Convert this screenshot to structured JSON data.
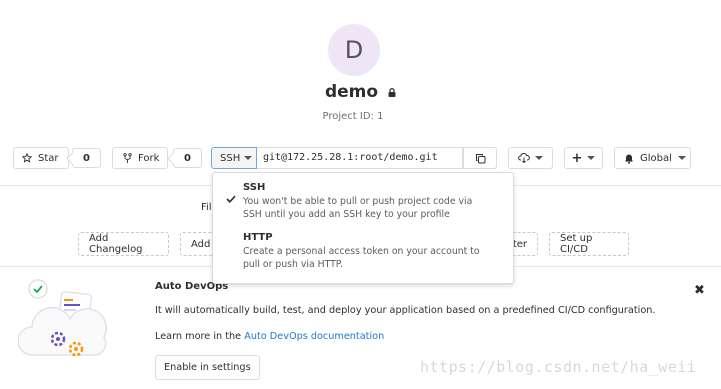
{
  "project": {
    "avatar_letter": "D",
    "name": "demo",
    "id_text": "Project ID: 1"
  },
  "actions": {
    "star_label": "Star",
    "star_count": "0",
    "fork_label": "Fork",
    "fork_count": "0",
    "protocol_label": "SSH",
    "clone_url": "git@172.25.28.1:root/demo.git",
    "notification_label": "Global"
  },
  "clone_dropdown": {
    "items": [
      {
        "title": "SSH",
        "description_line1": "You won't be able to pull or push project code via",
        "description_line2": "SSH until you add an SSH key to your profile",
        "checked": true
      },
      {
        "title": "HTTP",
        "description_line1": "Create a personal access token on your account to",
        "description_line2": "pull or push via HTTP.",
        "checked": false
      }
    ]
  },
  "quick_links": {
    "files_label": "Fil",
    "add_changelog": "Add Changelog",
    "add_partial": "Add",
    "partial_right": "ter",
    "setup_ci": "Set up CI/CD"
  },
  "auto_devops": {
    "title": "Auto DevOps",
    "description": "It will automatically build, test, and deploy your application based on a predefined CI/CD configuration.",
    "learn_prefix": "Learn more in the ",
    "learn_link": "Auto DevOps documentation",
    "enable_button": "Enable in settings",
    "close_glyph": "✖"
  },
  "watermark": "https://blog.csdn.net/ha_weii",
  "colors": {
    "avatar_bg": "#eee6f7",
    "link": "#1f78d1",
    "border": "#dcdcdc"
  }
}
